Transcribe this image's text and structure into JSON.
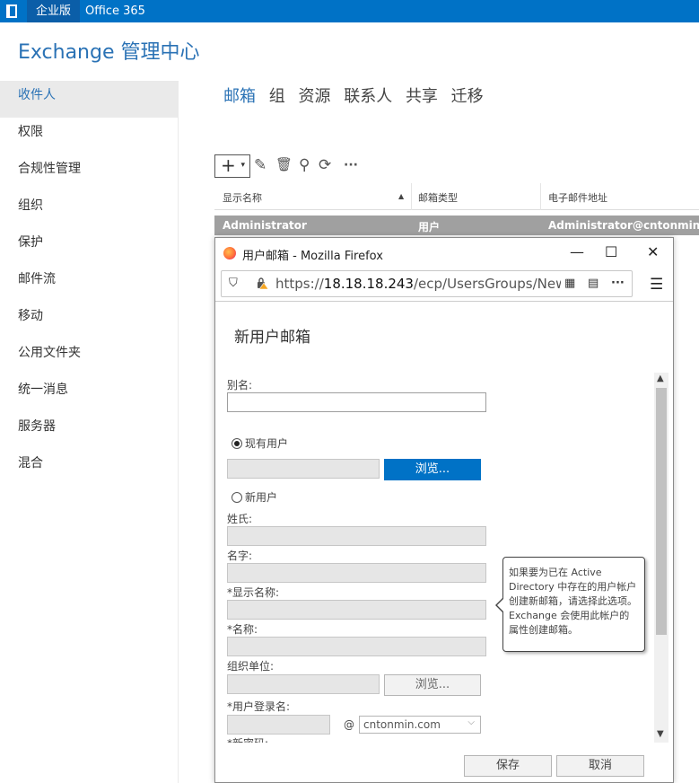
{
  "topbar": {
    "active_tab": "企业版",
    "tab2": "Office 365"
  },
  "app_title": "Exchange 管理中心",
  "left_nav": [
    "收件人",
    "权限",
    "合规性管理",
    "组织",
    "保护",
    "邮件流",
    "移动",
    "公用文件夹",
    "统一消息",
    "服务器",
    "混合"
  ],
  "sub_tabs": [
    "邮箱",
    "组",
    "资源",
    "联系人",
    "共享",
    "迁移"
  ],
  "toolbar": {
    "add": "+",
    "add_caret": "▾",
    "edit": "✎",
    "delete": "🗑",
    "search": "⚲",
    "refresh": "⟳",
    "more": "···"
  },
  "grid": {
    "columns": [
      "显示名称",
      "邮箱类型",
      "电子邮件地址"
    ],
    "sort_indicator": "▲",
    "row": {
      "name": "Administrator",
      "type": "用户",
      "email": "Administrator@cntonmin.com"
    }
  },
  "popup": {
    "window_title": "用户邮箱 - Mozilla Firefox",
    "controls": {
      "minimize": "—",
      "maximize": "☐",
      "close": "✕"
    },
    "url_prefix": "https://",
    "url_host": "18.18.18.243",
    "url_path": "/ecp/UsersGroups/NewMailb",
    "url_icons": {
      "shield": "⛉",
      "qr": "▦",
      "reader": "▤",
      "more": "···",
      "menu": "☰"
    },
    "form_title": "新用户邮箱",
    "fields": {
      "alias_label": "别名:",
      "existing_user": "现有用户",
      "browse": "浏览...",
      "new_user": "新用户",
      "surname": "姓氏:",
      "given_name": "名字:",
      "display_name": "*显示名称:",
      "name": "*名称:",
      "ou": "组织单位:",
      "logon_name": "*用户登录名:",
      "at": "@",
      "domain": "cntonmin.com",
      "password": "*新密码:"
    },
    "tooltip": "如果要为已在 Active Directory 中存在的用户帐户创建新邮箱，请选择此选项。Exchange 会使用此帐户的属性创建邮箱。",
    "scroll": {
      "up": "▲",
      "down": "▼"
    },
    "buttons": {
      "save": "保存",
      "cancel": "取消"
    }
  },
  "colors": {
    "accent": "#0072c6",
    "title_blue": "#2a72b5",
    "row_selected": "#a0a0a0"
  }
}
